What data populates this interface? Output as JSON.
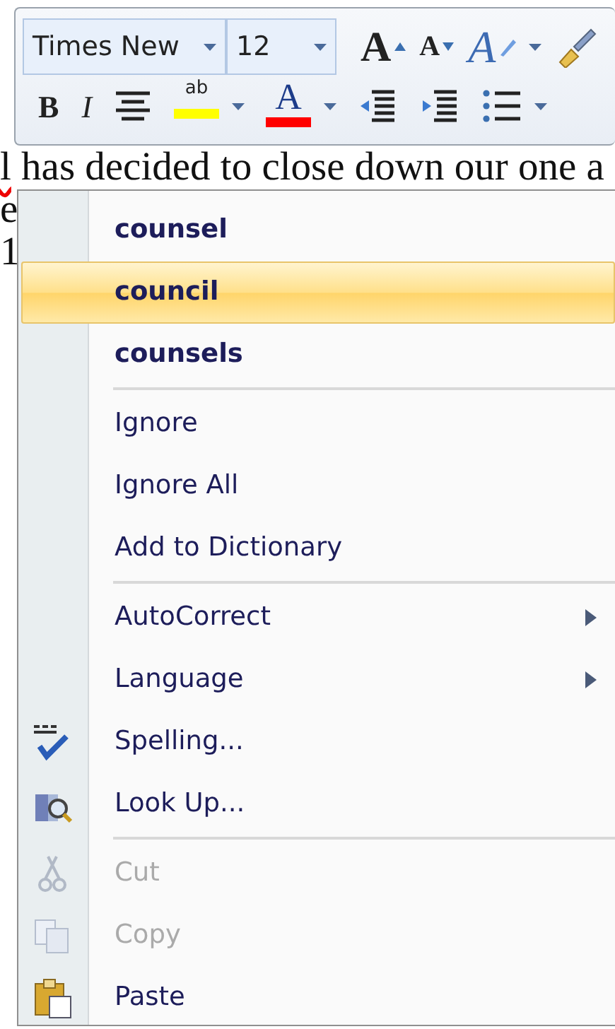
{
  "toolbar": {
    "font_name": "Times New",
    "font_size": "12",
    "row_1": [
      {
        "kind": "grow-font",
        "label": "A",
        "dropdown": false
      },
      {
        "kind": "shrink-font",
        "label": "A",
        "dropdown": false
      },
      {
        "kind": "styles",
        "label": "A",
        "dropdown": true
      },
      {
        "kind": "format-painter",
        "dropdown": false
      }
    ],
    "row_2": [
      {
        "kind": "bold",
        "label": "B",
        "dropdown": false
      },
      {
        "kind": "italic",
        "label": "I",
        "dropdown": false
      },
      {
        "kind": "center",
        "dropdown": false
      },
      {
        "kind": "highlight",
        "label": "ab",
        "dropdown": true,
        "color": "#ffff00"
      },
      {
        "kind": "font-color",
        "label": "A",
        "dropdown": true,
        "color": "#ff0000"
      },
      {
        "kind": "decrease-indent",
        "dropdown": false
      },
      {
        "kind": "increase-indent",
        "dropdown": false
      },
      {
        "kind": "bullets",
        "dropdown": true
      }
    ]
  },
  "document": {
    "lines": [
      [
        {
          "text": "l",
          "misspelled": true
        },
        {
          "text": " has decided to close down our one a",
          "misspelled": false
        }
      ],
      [
        {
          "text": "e",
          "misspelled": false
        }
      ],
      [
        {
          "text": "1",
          "misspelled": false
        }
      ]
    ]
  },
  "context_menu": {
    "items": [
      {
        "kind": "suggestion",
        "label": "counsel",
        "selected": false,
        "disabled": false
      },
      {
        "kind": "suggestion",
        "label": "council",
        "selected": true,
        "disabled": false
      },
      {
        "kind": "suggestion",
        "label": "counsels",
        "selected": false,
        "disabled": false
      },
      {
        "kind": "separator"
      },
      {
        "kind": "command",
        "label": "Ignore",
        "selected": false,
        "disabled": false
      },
      {
        "kind": "command",
        "label": "Ignore All",
        "selected": false,
        "disabled": false
      },
      {
        "kind": "command",
        "label": "Add to Dictionary",
        "selected": false,
        "disabled": false
      },
      {
        "kind": "separator"
      },
      {
        "kind": "submenu",
        "label": "AutoCorrect",
        "selected": false,
        "disabled": false
      },
      {
        "kind": "submenu",
        "label": "Language",
        "selected": false,
        "disabled": false
      },
      {
        "kind": "spelling",
        "label": "Spelling...",
        "selected": false,
        "disabled": false
      },
      {
        "kind": "lookup",
        "label": "Look Up...",
        "selected": false,
        "disabled": false
      },
      {
        "kind": "separator"
      },
      {
        "kind": "cut",
        "label": "Cut",
        "selected": false,
        "disabled": true
      },
      {
        "kind": "copy",
        "label": "Copy",
        "selected": false,
        "disabled": true
      },
      {
        "kind": "paste",
        "label": "Paste",
        "selected": false,
        "disabled": false
      }
    ]
  }
}
